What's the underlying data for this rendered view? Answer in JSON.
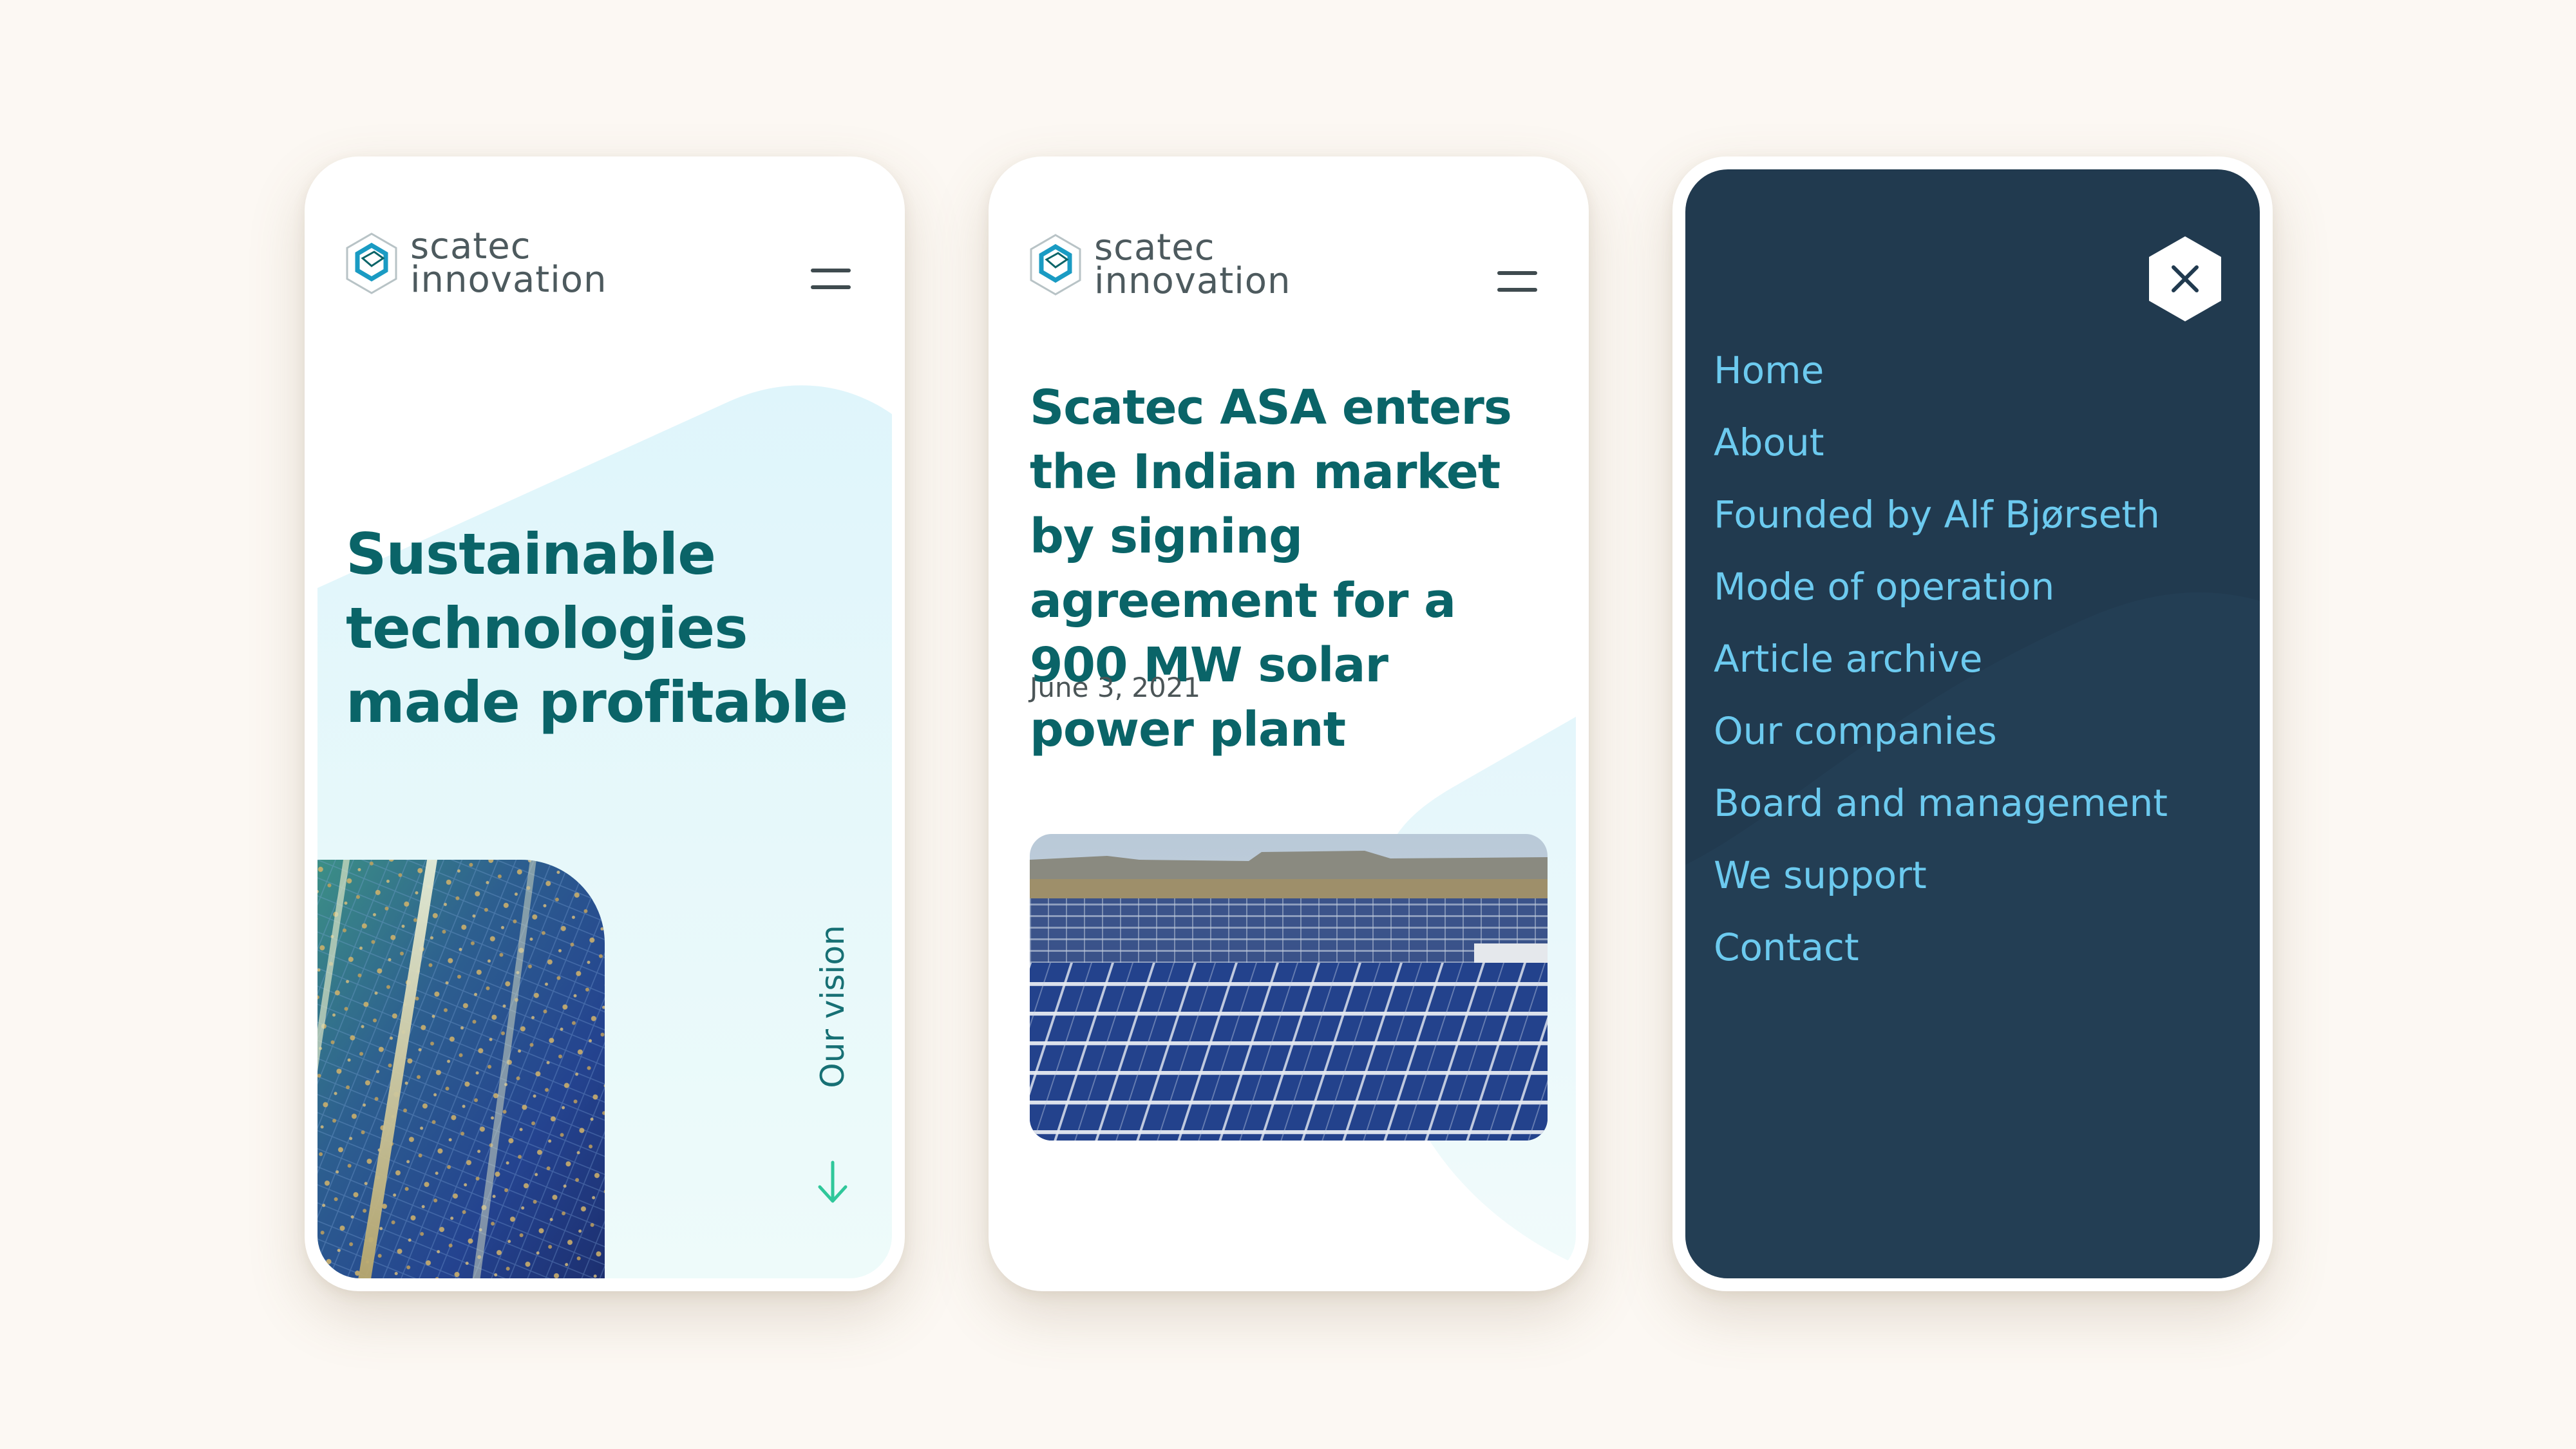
{
  "brand": {
    "logo_line1": "scatec",
    "logo_line2": "innovation"
  },
  "screens": {
    "home": {
      "headline": "Sustainable technologies made profitable",
      "vision_link": "Our vision"
    },
    "article": {
      "title": "Scatec ASA enters the Indian market by signing agreement for a 900 MW solar power plant",
      "date": "June 3, 2021"
    },
    "menu": {
      "items": [
        "Home",
        "About",
        "Founded by Alf Bjørseth",
        "Mode of operation",
        "Article archive",
        "Our companies",
        "Board and management",
        "We support",
        "Contact"
      ]
    }
  },
  "colors": {
    "page_background": "#fcf8f3",
    "brand_teal": "#0a6468",
    "accent_green": "#2fc79a",
    "menu_background": "#213a4f",
    "menu_link": "#6ccaef"
  },
  "icons": {
    "logo": "hexagon-cube-icon",
    "menu": "hamburger-icon",
    "scroll": "arrow-down-icon",
    "close": "close-icon"
  }
}
